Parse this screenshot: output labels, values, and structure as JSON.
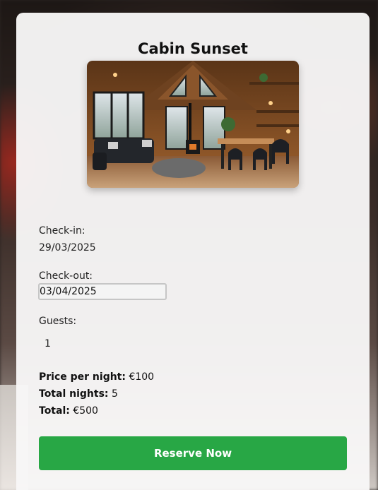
{
  "listing": {
    "title": "Cabin Sunset",
    "photo_alt": "cabin-interior-photo"
  },
  "booking": {
    "checkin_label": "Check-in:",
    "checkin_value": "29/03/2025",
    "checkout_label": "Check-out:",
    "checkout_value": "03/04/2025",
    "guests_label": "Guests:",
    "guests_value": "1"
  },
  "summary": {
    "price_label": "Price per night:",
    "price_value": "€100",
    "nights_label": "Total nights:",
    "nights_value": "5",
    "total_label": "Total:",
    "total_value": "€500"
  },
  "actions": {
    "reserve_label": "Reserve Now"
  },
  "colors": {
    "accent": "#28a745"
  }
}
